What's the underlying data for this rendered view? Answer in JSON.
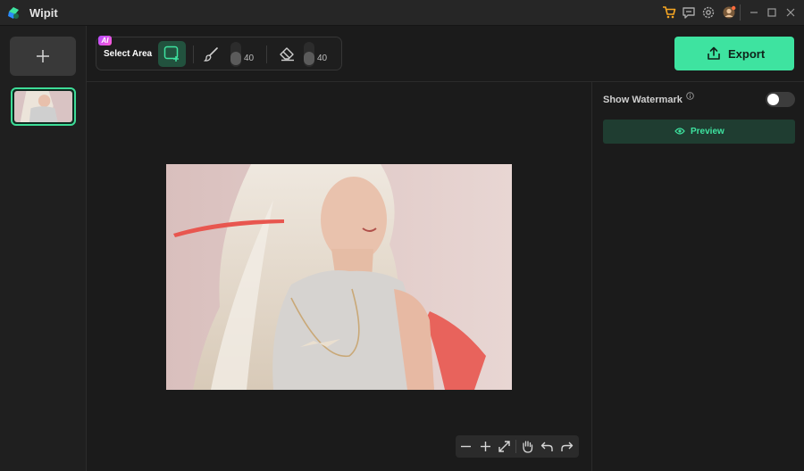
{
  "app": {
    "title": "Wipit"
  },
  "toolbar": {
    "ai_badge": "AI",
    "select_area_label": "Select Area",
    "brush_size": "40",
    "eraser_size": "40",
    "brush_size_level": 40,
    "eraser_size_level": 40
  },
  "export": {
    "label": "Export"
  },
  "right_panel": {
    "show_watermark_label": "Show Watermark",
    "watermark_enabled": false,
    "preview_label": "Preview"
  },
  "colors": {
    "accent": "#3ee3a0",
    "accent_dark": "#22523e",
    "brush_stroke": "#e8564f",
    "background": "#1b1b1b"
  },
  "icons": {
    "titlebar": [
      "cart-icon",
      "feedback-icon",
      "settings-icon",
      "avatar-icon"
    ],
    "window": [
      "minimize-icon",
      "maximize-icon",
      "close-icon"
    ],
    "zoom": [
      "zoom-out-icon",
      "zoom-in-icon",
      "fit-screen-icon",
      "hand-pan-icon",
      "undo-icon",
      "redo-icon"
    ]
  }
}
